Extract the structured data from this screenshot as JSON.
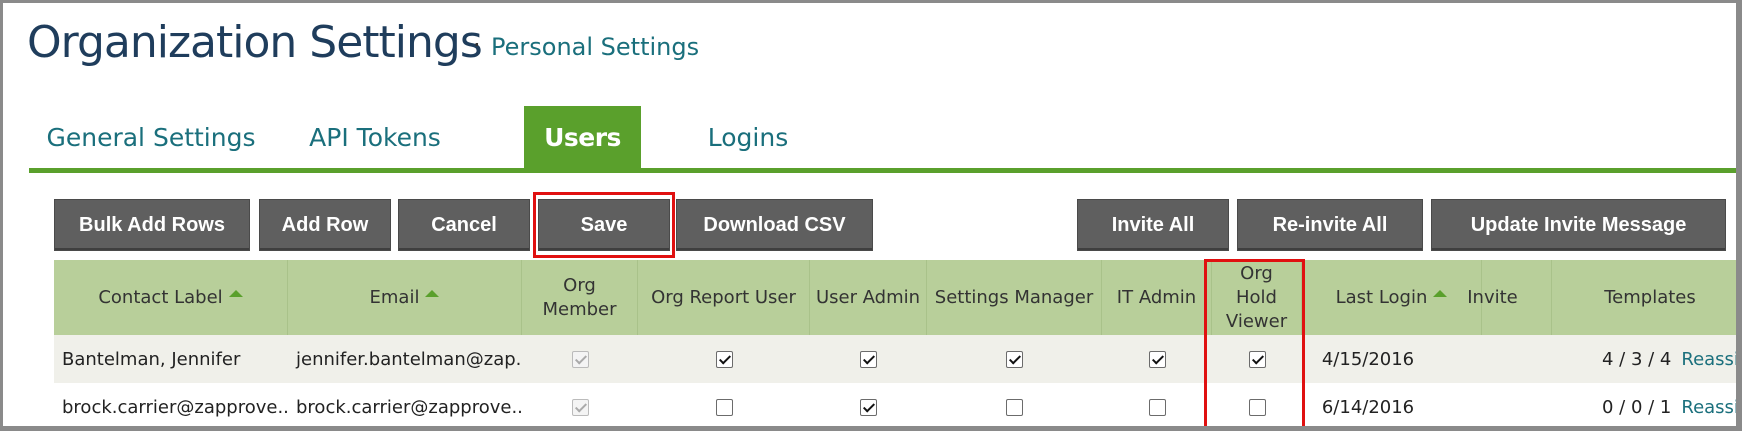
{
  "header": {
    "title": "Organization Settings",
    "separator": "·",
    "personal_link": "Personal Settings"
  },
  "tabs": [
    {
      "label": "General Settings",
      "active": false
    },
    {
      "label": "API Tokens",
      "active": false
    },
    {
      "label": "Users",
      "active": true
    },
    {
      "label": "Logins",
      "active": false
    }
  ],
  "toolbar": {
    "bulk_add_rows": "Bulk Add Rows",
    "add_row": "Add Row",
    "cancel": "Cancel",
    "save": "Save",
    "download_csv": "Download CSV",
    "invite_all": "Invite All",
    "reinvite_all": "Re-invite All",
    "update_invite_message": "Update Invite Message"
  },
  "table": {
    "columns": {
      "contact_label": "Contact Label",
      "email": "Email",
      "org_member": "Org Member",
      "org_report_user": "Org Report User",
      "user_admin": "User Admin",
      "settings_manager": "Settings Manager",
      "it_admin": "IT Admin",
      "org_hold_viewer": "Org Hold Viewer",
      "last_login": "Last Login",
      "invite": "Invite",
      "templates": "Templates"
    },
    "rows": [
      {
        "contact_label": "Bantelman, Jennifer",
        "email": "jennifer.bantelman@zap...",
        "org_member": true,
        "org_report_user": true,
        "user_admin": true,
        "settings_manager": true,
        "it_admin": true,
        "org_hold_viewer": true,
        "last_login": "4/15/2016",
        "templates": "4 / 3 / 4",
        "reassign": "Reassign"
      },
      {
        "contact_label": "brock.carrier@zapprove...",
        "email": "brock.carrier@zapprove...",
        "org_member": true,
        "org_report_user": false,
        "user_admin": true,
        "settings_manager": false,
        "it_admin": false,
        "org_hold_viewer": false,
        "last_login": "6/14/2016",
        "templates": "0 / 0 / 1",
        "reassign": "Reassign"
      }
    ]
  },
  "colors": {
    "accent_green": "#5aa02c",
    "header_green": "#b8cf9a",
    "button_gray": "#5f5f5f",
    "link_teal": "#1a6f7c",
    "title_navy": "#1f3d5c",
    "highlight_red": "#e01010"
  }
}
